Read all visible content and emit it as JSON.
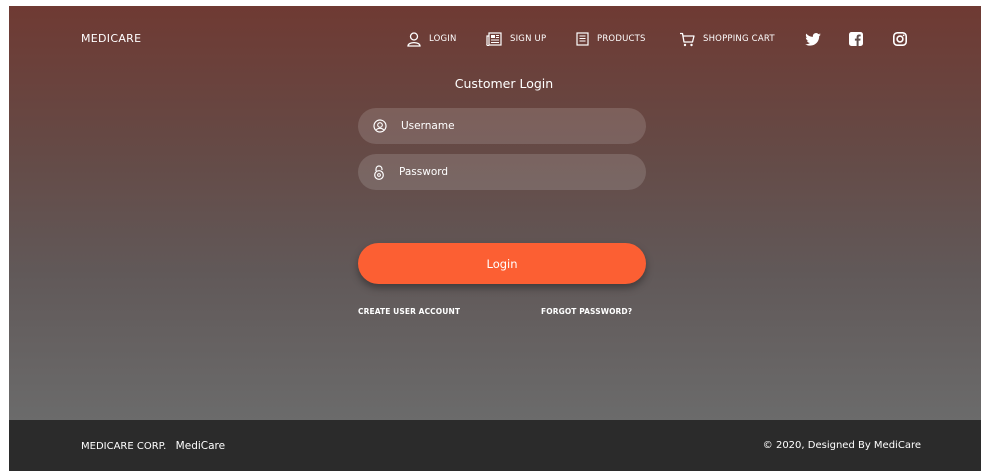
{
  "brand": "MEDICARE",
  "nav": {
    "login": "LOGIN",
    "signup": "SIGN UP",
    "products": "PRODUCTS",
    "cart": "SHOPPING CART"
  },
  "social": [
    "twitter-icon",
    "facebook-icon",
    "instagram-icon"
  ],
  "form": {
    "title": "Customer Login",
    "username_placeholder": "Username",
    "password_placeholder": "Password",
    "username_value": "",
    "password_value": "",
    "login_label": "Login",
    "create_account": "CREATE USER ACCOUNT",
    "forgot_password": "FORGOT PASSWORD?"
  },
  "footer": {
    "corp": "MEDICARE CORP.",
    "name": "MediCare",
    "copyright": "© 2020, Designed By MediCare"
  },
  "colors": {
    "accent": "#fc5f33",
    "footer_bg": "#2b2b2b",
    "hero_top": "#6f3a33",
    "hero_bottom": "#6b6b6b"
  }
}
